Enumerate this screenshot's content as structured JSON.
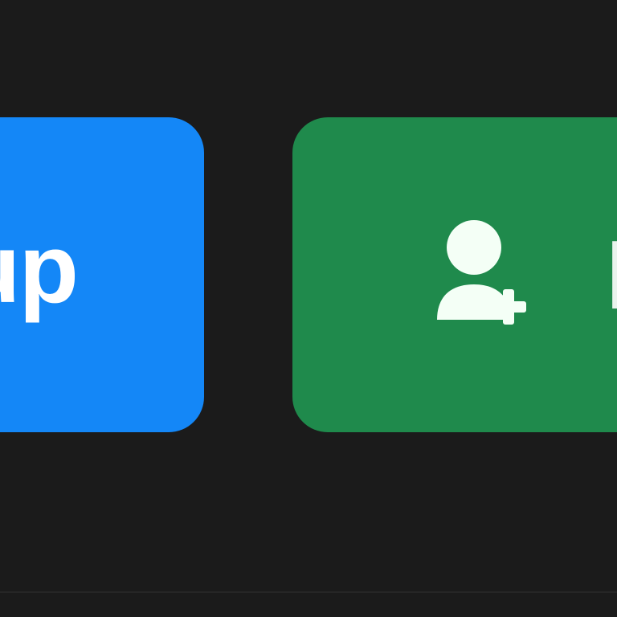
{
  "buttons": {
    "blue": {
      "label": "up",
      "color": "#1487f7"
    },
    "green": {
      "icon": "add-user-icon",
      "label": "I",
      "color": "#1f8a4c"
    }
  },
  "colors": {
    "background": "#1b1b1b",
    "text": "#ffffff"
  }
}
